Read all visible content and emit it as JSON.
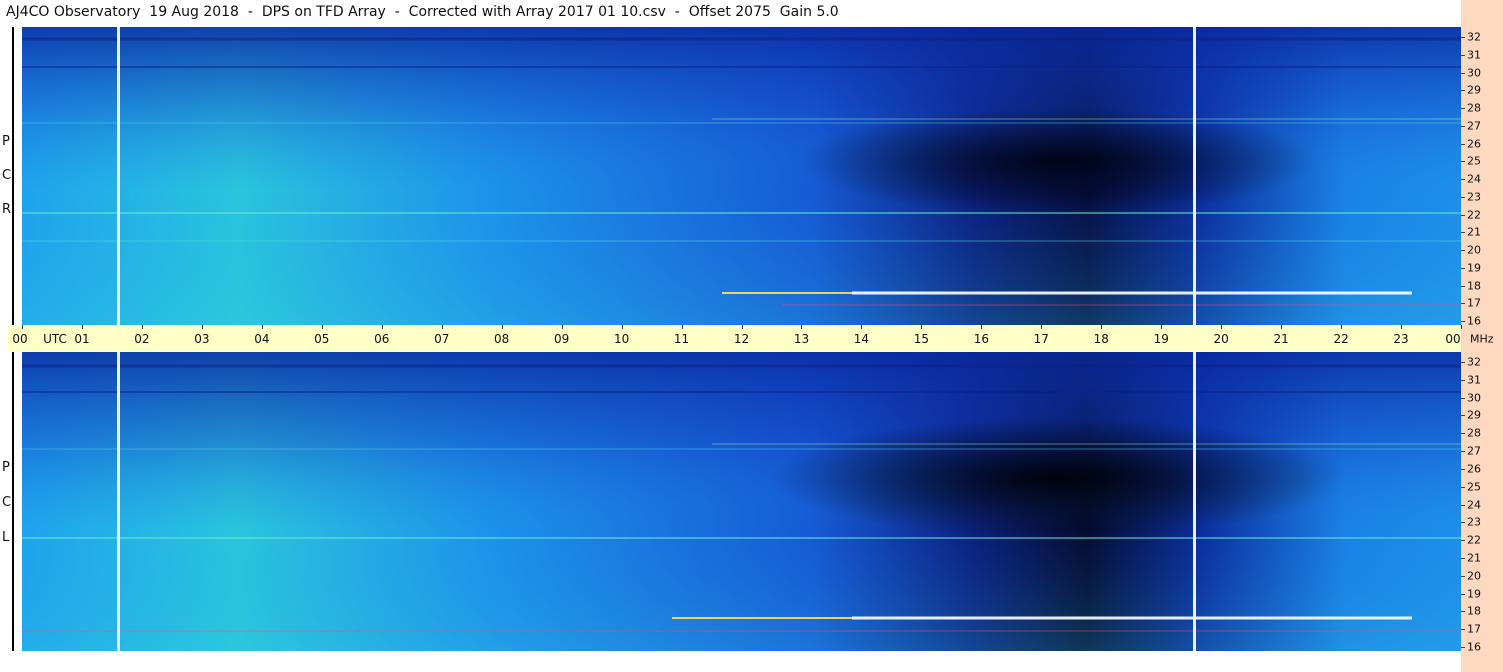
{
  "title": "AJ4CO Observatory  19 Aug 2018  -  DPS on TFD Array  -  Corrected with Array 2017 01 10.csv  -  Offset 2075  Gain 5.0",
  "chart_data": {
    "type": "heatmap",
    "title": "AJ4CO Observatory  19 Aug 2018  -  DPS on TFD Array  -  Corrected with Array 2017 01 10.csv  -  Offset 2075  Gain 5.0",
    "x_axis": {
      "unit_label": "UTC",
      "range": [
        0,
        24
      ],
      "tick_labels": [
        "00",
        "UTC",
        "01",
        "02",
        "03",
        "04",
        "05",
        "06",
        "07",
        "08",
        "09",
        "10",
        "11",
        "12",
        "13",
        "14",
        "15",
        "16",
        "17",
        "18",
        "19",
        "20",
        "21",
        "22",
        "23",
        "00"
      ]
    },
    "y_axis": {
      "unit_label": "MHz",
      "range": [
        16,
        32
      ],
      "tick_labels": [
        "32",
        "31",
        "30",
        "29",
        "28",
        "27",
        "26",
        "25",
        "24",
        "23",
        "22",
        "21",
        "20",
        "19",
        "18",
        "17",
        "16"
      ]
    },
    "panels": [
      {
        "name": "R C P",
        "label_letters": [
          "R",
          "C",
          "P"
        ]
      },
      {
        "name": "L C P",
        "label_letters": [
          "L",
          "C",
          "P"
        ]
      }
    ],
    "vertical_gaps_utc": [
      1.65,
      19.55
    ],
    "colors": {
      "bright": "#3fd6e0",
      "mid": "#1e7fe8",
      "low": "#1336c2",
      "dark": "#04093a",
      "background_strip": "#fcd9c0",
      "axis_band": "#ffffc8"
    }
  }
}
